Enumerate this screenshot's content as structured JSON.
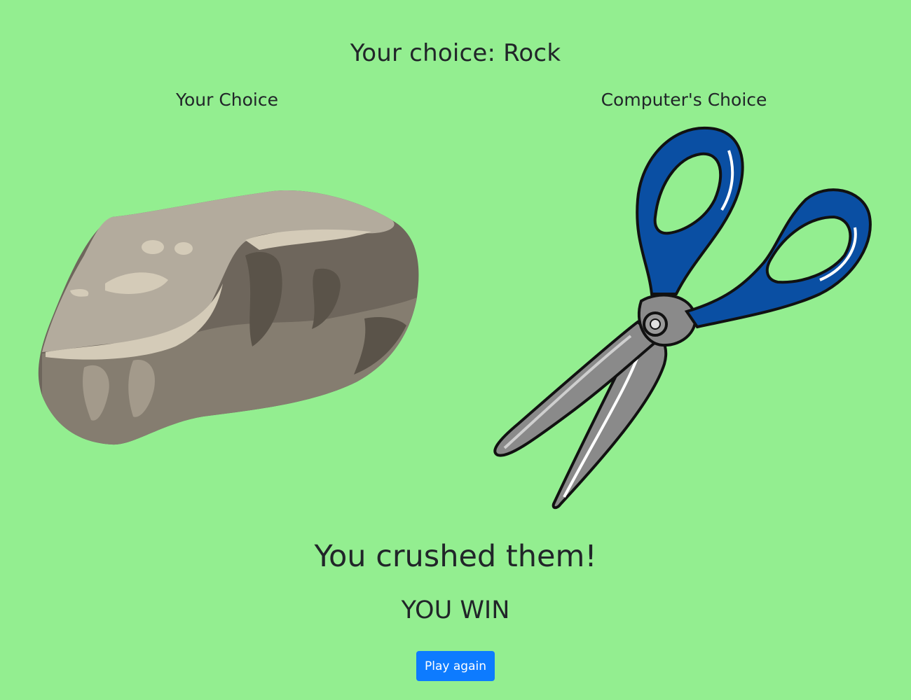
{
  "header": {
    "title": "Your choice: Rock"
  },
  "player": {
    "label": "Your Choice",
    "choice_icon": "rock-icon"
  },
  "computer": {
    "label": "Computer's Choice",
    "choice_icon": "scissors-icon"
  },
  "outcome": {
    "message": "You crushed them!",
    "verdict": "YOU WIN"
  },
  "actions": {
    "play_again_label": "Play again"
  },
  "colors": {
    "background": "#93ee90",
    "button": "#0d7bff",
    "scissors_handle": "#0a4fa3",
    "rock": "#a8a094"
  }
}
